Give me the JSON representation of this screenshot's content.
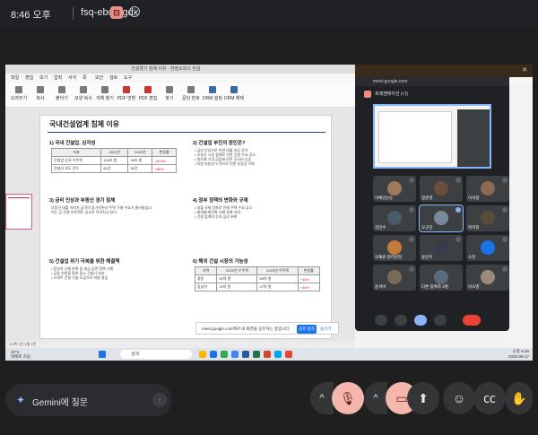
{
  "topbar": {
    "time": "8:46 오후",
    "meeting_code": "fsq-ebqh-gdx"
  },
  "app": {
    "window_title": "건설경기 침체 이유 - 한컴오피스 한글",
    "menu": [
      "파일",
      "편집",
      "보기",
      "입력",
      "서식",
      "쪽",
      "보안",
      "검토",
      "도구"
    ],
    "ribbon": [
      "오려두기",
      "복사",
      "붙이기",
      "모양 복사",
      "개체 찾기",
      "PDF 변환",
      "PDF 편집",
      "찾기",
      "문단 번호",
      "DRM 설정",
      "DRM 해제"
    ],
    "status": "1/1쪽  1단  1줄  1칸"
  },
  "doc": {
    "title": "국내건설업계 침체 이유",
    "sections": [
      {
        "title": "1) 국내 건설업, 심각성",
        "body": ""
      },
      {
        "title": "2) 건설업 부진의 원인은?",
        "body": "• 금리 인상으로 인한 대출 부담 증가\n• 부동산 시장 침체로 인한 건설 수요 감소\n• 원자재 가격 급등에 따른 공사비 상승\n• 지방 미분양 누적으로 인한 유동성 악화"
      },
      {
        "title": "3) 금리 인상과 부동산 경기 침체",
        "body": "부동산 대출 이자가 급격히 증가하면서 주택 구매 수요가 줄어들었고,\n이는 곧 건설 프로젝트 감소로 이어지고 있다."
      },
      {
        "title": "4) 정부 정책의 변화와 규제",
        "body": "• 대출 규제 강화로 인해 주택 수요 감소\n• 재개발/재건축 규제 완화 지연\n• 건설 업계의 투자 심리 위축"
      },
      {
        "title": "5) 건설업 위기 극복을 위한 해결책",
        "body": "• 정부의 규제 완화 및 세금 감면 정책 시행\n• 금융 지원을 통한 중소 건설사 보호\n• 스마트 건설 기술 도입으로 비용 절감"
      },
      {
        "title": "6) 해외 건설 시장의 가능성",
        "body": ""
      }
    ],
    "table1": {
      "headers": [
        "지표",
        "2022년",
        "2023년",
        "변동률"
      ],
      "rows": [
        [
          "건설업 신규 수주액",
          "126조 원",
          "95조 원",
          "-20.8%"
        ],
        [
          "건설사 부도 건수",
          "50건",
          "90건",
          "+80%"
        ]
      ]
    },
    "table2": {
      "headers": [
        "지역",
        "2022년 수주액",
        "2023년 수주액",
        "변동률"
      ],
      "rows": [
        [
          "중동",
          "50억 원",
          "65억 원",
          "+30%"
        ],
        [
          "동남아",
          "20억 원",
          "27억 원",
          "+35%"
        ]
      ]
    }
  },
  "share_notice": {
    "text": "meet.google.com에서 내 화면을 공유하는 중입니다.",
    "stop": "공유 중지",
    "hide": "숨기기"
  },
  "taskbar": {
    "weather": "20°C\n대체로 흐림",
    "search": "검색",
    "clock": "오후 8:46\n2025-06-17"
  },
  "pip": {
    "url": "meet.google.com",
    "header": "프레젠테이션 (나)",
    "tiles": [
      {
        "name": "이예인(나)",
        "color": "#a0785a"
      },
      {
        "name": "정준영",
        "color": "#6b4f3a"
      },
      {
        "name": "이서형",
        "color": "#8a6a50"
      },
      {
        "name": "김민수",
        "color": "#4a5a6a"
      },
      {
        "name": "오규민",
        "color": "#7a8a9a"
      },
      {
        "name": "박지현",
        "color": "#5a4a3a"
      },
      {
        "name": "오예원 정리반장",
        "color": "#c47a3a"
      },
      {
        "name": "송민우",
        "color": "#3a3a4a"
      },
      {
        "name": "소현",
        "color": "#1a73e8"
      },
      {
        "name": "윤서아",
        "color": "#7a6a5a"
      },
      {
        "name": "다른 참여자 3명",
        "color": "#5a6a7a"
      },
      {
        "name": "이소영",
        "color": "#9a8a7a"
      }
    ]
  },
  "gemini": {
    "label": "Gemini에 질문"
  }
}
